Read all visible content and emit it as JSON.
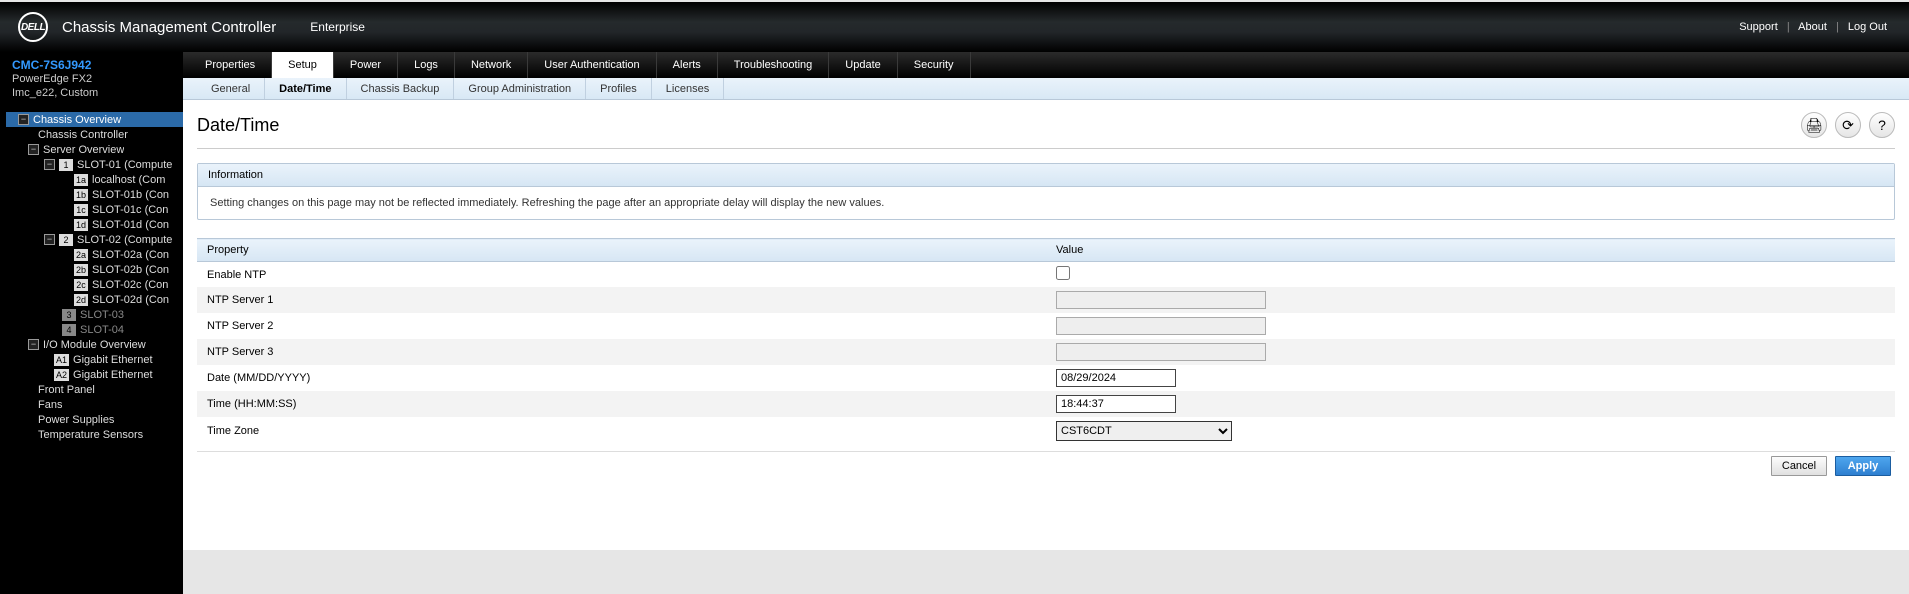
{
  "header": {
    "logo_text": "DELL",
    "app_title": "Chassis Management Controller",
    "context": "Enterprise",
    "links": {
      "support": "Support",
      "about": "About",
      "logout": "Log Out"
    }
  },
  "chassis": {
    "service_tag": "CMC-7S6J942",
    "model": "PowerEdge FX2",
    "extra": "Imc_e22, Custom"
  },
  "tree": {
    "chassis_overview": "Chassis Overview",
    "chassis_controller": "Chassis Controller",
    "server_overview": "Server Overview",
    "slot01": "SLOT-01 (Compute",
    "slot01_children": [
      {
        "badge": "1a",
        "label": "localhost (Com"
      },
      {
        "badge": "1b",
        "label": "SLOT-01b (Con"
      },
      {
        "badge": "1c",
        "label": "SLOT-01c (Con"
      },
      {
        "badge": "1d",
        "label": "SLOT-01d (Con"
      }
    ],
    "slot02": "SLOT-02 (Compute",
    "slot02_children": [
      {
        "badge": "2a",
        "label": "SLOT-02a (Con"
      },
      {
        "badge": "2b",
        "label": "SLOT-02b (Con"
      },
      {
        "badge": "2c",
        "label": "SLOT-02c (Con"
      },
      {
        "badge": "2d",
        "label": "SLOT-02d (Con"
      }
    ],
    "slot03": "SLOT-03",
    "slot04": "SLOT-04",
    "io_overview": "I/O Module Overview",
    "io_children": [
      {
        "badge": "A1",
        "label": "Gigabit Ethernet"
      },
      {
        "badge": "A2",
        "label": "Gigabit Ethernet"
      }
    ],
    "front_panel": "Front Panel",
    "fans": "Fans",
    "power_supplies": "Power Supplies",
    "temp_sensors": "Temperature Sensors"
  },
  "maintabs": [
    "Properties",
    "Setup",
    "Power",
    "Logs",
    "Network",
    "User Authentication",
    "Alerts",
    "Troubleshooting",
    "Update",
    "Security"
  ],
  "maintab_active": 1,
  "subtabs": [
    "General",
    "Date/Time",
    "Chassis Backup",
    "Group Administration",
    "Profiles",
    "Licenses"
  ],
  "subtab_active": 1,
  "page": {
    "title": "Date/Time",
    "info_header": "Information",
    "info_text": "Setting changes on this page may not be reflected immediately. Refreshing the page after an appropriate delay will display the new values.",
    "col_property": "Property",
    "col_value": "Value",
    "rows": {
      "enable_ntp": "Enable NTP",
      "ntp1": "NTP Server 1",
      "ntp2": "NTP Server 2",
      "ntp3": "NTP Server 3",
      "date": "Date (MM/DD/YYYY)",
      "time": "Time (HH:MM:SS)",
      "tz": "Time Zone"
    },
    "values": {
      "enable_ntp": false,
      "ntp1": "",
      "ntp2": "",
      "ntp3": "",
      "date": "08/29/2024",
      "time": "18:44:37",
      "tz": "CST6CDT"
    },
    "btn_cancel": "Cancel",
    "btn_apply": "Apply"
  },
  "icons": {
    "print": "🖨",
    "refresh": "⟳",
    "help": "?"
  }
}
